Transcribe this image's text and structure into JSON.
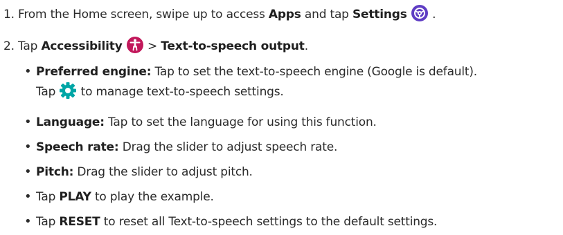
{
  "steps": [
    {
      "number": "1.",
      "text_a": "From the Home screen, swipe up to access ",
      "bold_a": "Apps",
      "text_b": " and tap ",
      "bold_b": "Settings",
      "trailing": " .",
      "icon": "settings-gear-icon",
      "icon_color": "#5f3dc4"
    },
    {
      "number": "2.",
      "text_a": "Tap ",
      "bold_a": "Accessibility",
      "separator": " > ",
      "bold_b": "Text-to-speech output",
      "trailing": ".",
      "icon": "accessibility-icon",
      "icon_color": "#c2185b"
    }
  ],
  "bullets": [
    {
      "label": "Preferred engine:",
      "text": " Tap to set the text-to-speech engine (Google is default).",
      "cont_a": "Tap ",
      "cont_icon": "settings-cog-icon",
      "cont_icon_color": "#00a6a6",
      "cont_b": " to manage text-to-speech settings."
    },
    {
      "label": "Language:",
      "text": " Tap to set the language for using this function."
    },
    {
      "label": "Speech rate:",
      "text": " Drag the slider to adjust speech rate."
    },
    {
      "label": "Pitch:",
      "text": " Drag the slider to adjust pitch."
    },
    {
      "pre": "Tap ",
      "label": "PLAY",
      "text": " to play the example."
    },
    {
      "pre": "Tap ",
      "label": "RESET",
      "text": " to reset all Text-to-speech settings to the default settings."
    }
  ],
  "bullet_char": "•"
}
